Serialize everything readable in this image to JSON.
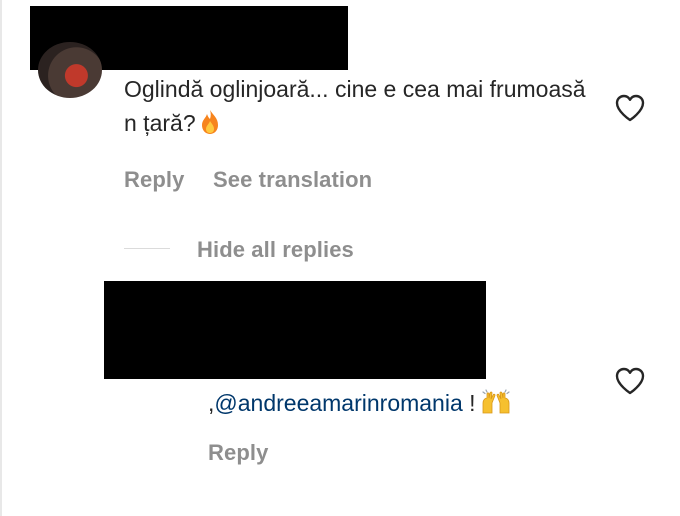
{
  "comment": {
    "text": "Oglindă oglinjoară... cine e cea mai frumoasă n țară?",
    "emoji_icon": "fire-emoji",
    "reply_label": "Reply",
    "translate_label": "See translation",
    "like_icon": "heart-icon"
  },
  "replies_toggle": {
    "label": "Hide all replies"
  },
  "reply": {
    "prefix": ",",
    "mention": "@andreeamarinromania",
    "suffix": " !",
    "emoji_icon": "raising-hands-emoji",
    "reply_label": "Reply",
    "like_icon": "heart-icon"
  },
  "colors": {
    "text": "#262626",
    "secondary": "#8e8e8e",
    "mention": "#00376b",
    "redaction": "#000000"
  }
}
